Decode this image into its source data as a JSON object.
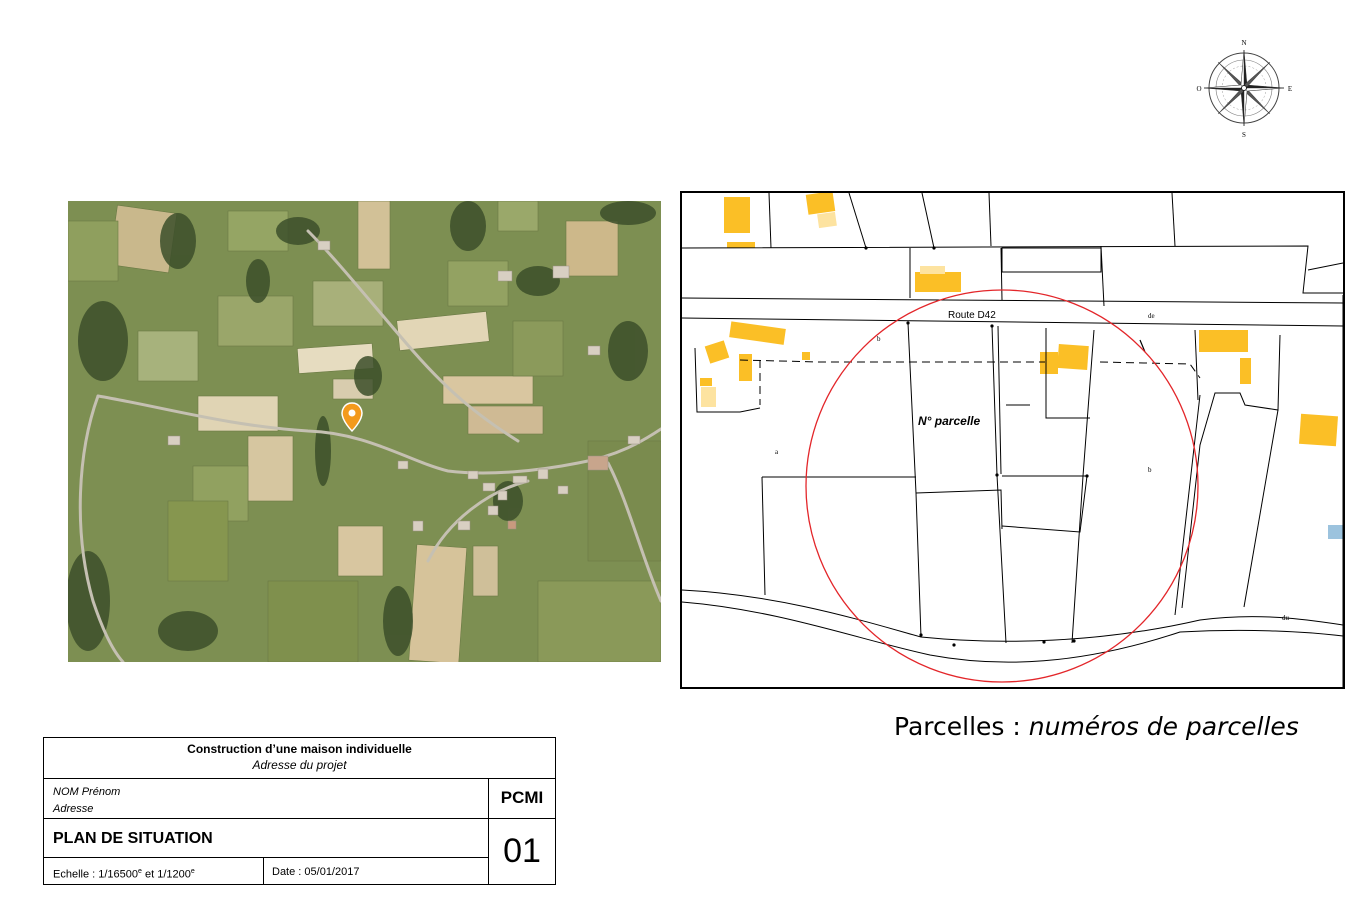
{
  "compass": {
    "north": "N",
    "south": "S",
    "east": "E",
    "west": "O"
  },
  "cadastre": {
    "road_label": "Route D42",
    "parcel_label": "N° parcelle",
    "small_labels": [
      "b",
      "de",
      "a",
      "b",
      "du"
    ],
    "colors": {
      "building": "#fbbf26",
      "building_light": "#fde3a0",
      "radius_circle": "#e3262a",
      "water": "#9cc3de"
    }
  },
  "caption": {
    "prefix": "Parcelles : ",
    "emphasis": "numéros de parcelles"
  },
  "title_block": {
    "project_title": "Construction d’une maison individuelle",
    "project_address": "Adresse du projet",
    "owner_name": "NOM Prénom",
    "owner_address": "Adresse",
    "form_code": "PCMI",
    "document_title": "PLAN DE SITUATION",
    "document_number": "01",
    "scale": "Echelle : 1/16500e et 1/1200e",
    "date": "Date : 05/01/2017"
  },
  "aerial": {
    "marker_color": "#f39a1d",
    "marker_icon": "location-pin-icon"
  }
}
